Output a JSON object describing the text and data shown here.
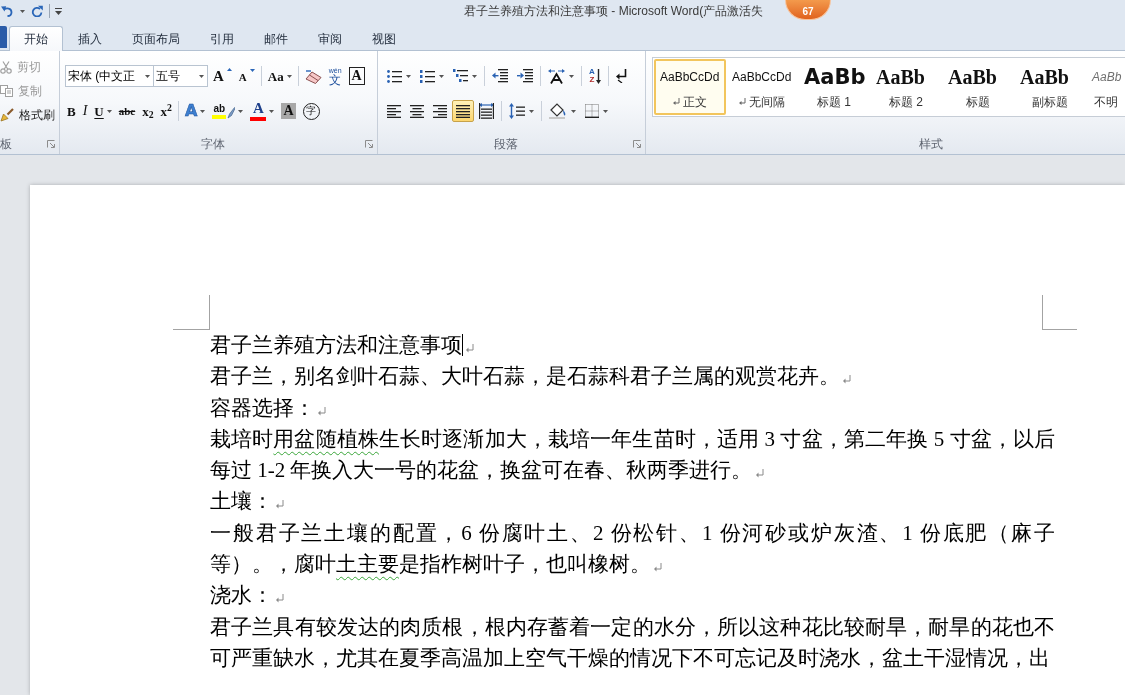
{
  "window": {
    "title": "君子兰养殖方法和注意事项 - Microsoft Word(产品激活失"
  },
  "badge": {
    "text": "67"
  },
  "tabs": [
    {
      "label": "开始",
      "selected": true
    },
    {
      "label": "插入",
      "selected": false
    },
    {
      "label": "页面布局",
      "selected": false
    },
    {
      "label": "引用",
      "selected": false
    },
    {
      "label": "邮件",
      "selected": false
    },
    {
      "label": "审阅",
      "selected": false
    },
    {
      "label": "视图",
      "selected": false
    }
  ],
  "clipboard": {
    "label": "板",
    "items": [
      {
        "kind": "cut",
        "label": "剪切",
        "disabled": true
      },
      {
        "kind": "copy",
        "label": "复制",
        "disabled": true
      },
      {
        "kind": "painter",
        "label": "格式刷",
        "disabled": false
      }
    ]
  },
  "font": {
    "label": "字体",
    "font_name": "宋体 (中文正",
    "font_size": "五号",
    "row_1": [
      [
        {
          "kind": "grow",
          "glyph": "A",
          "dropdown": false
        },
        {
          "kind": "shrink",
          "glyph": "A",
          "dropdown": false
        }
      ],
      [
        {
          "kind": "case",
          "glyph": "Aa",
          "dropdown": true
        }
      ],
      [
        {
          "kind": "clear",
          "dropdown": false
        },
        {
          "kind": "phonetic",
          "glyph": "文",
          "ruby": "wén",
          "dropdown": false
        },
        {
          "kind": "border",
          "glyph": "A",
          "dropdown": false
        }
      ]
    ],
    "row_2": [
      [
        {
          "kind": "bold",
          "glyph": "B",
          "dropdown": false
        },
        {
          "kind": "italic",
          "glyph": "I",
          "dropdown": false
        },
        {
          "kind": "underline",
          "glyph": "U",
          "dropdown": true
        },
        {
          "kind": "strike",
          "glyph": "abc",
          "dropdown": false
        },
        {
          "kind": "subscript",
          "glyph": "x$_{2}$",
          "dropdown": false
        },
        {
          "kind": "superscript",
          "glyph": "x$^{2}$",
          "dropdown": false
        }
      ],
      [
        {
          "kind": "effects",
          "glyph": "A",
          "dropdown": true
        },
        {
          "kind": "highlight",
          "glyph": "ab",
          "dropdown": true,
          "color": "#ffff00"
        },
        {
          "kind": "color",
          "glyph": "A",
          "dropdown": true,
          "color": "#ff0000"
        },
        {
          "kind": "shading",
          "glyph": "A",
          "dropdown": false
        },
        {
          "kind": "enclosed",
          "glyph": "字",
          "dropdown": false
        }
      ]
    ]
  },
  "paragraph": {
    "label": "段落",
    "row_1": [
      [
        {
          "kind": "bullets",
          "dropdown": true
        },
        {
          "kind": "numbering",
          "dropdown": true
        },
        {
          "kind": "multilevel",
          "dropdown": true
        }
      ],
      [
        {
          "kind": "outdent",
          "dropdown": false
        },
        {
          "kind": "indent",
          "dropdown": false
        }
      ],
      [
        {
          "kind": "asian_layout",
          "dropdown": true
        }
      ],
      [
        {
          "kind": "sort",
          "glyph": "A",
          "glyph_2": "Z",
          "dropdown": false
        }
      ],
      [
        {
          "kind": "show_marks",
          "dropdown": false
        }
      ]
    ],
    "row_2": [
      [
        {
          "kind": "align_left",
          "selected": false,
          "dropdown": false
        },
        {
          "kind": "align_center",
          "selected": false,
          "dropdown": false
        },
        {
          "kind": "align_right",
          "selected": false,
          "dropdown": false
        },
        {
          "kind": "justify",
          "selected": true,
          "dropdown": false
        },
        {
          "kind": "distribute",
          "selected": false,
          "dropdown": false
        }
      ],
      [
        {
          "kind": "line_spacing",
          "dropdown": true
        }
      ],
      [
        {
          "kind": "shading",
          "dropdown": true
        },
        {
          "kind": "borders",
          "dropdown": true
        }
      ]
    ]
  },
  "styles": {
    "label": "样式",
    "items": [
      {
        "kind": "normal",
        "sample": "AaBbCcDd",
        "label": "正文",
        "mark": true,
        "selected": true
      },
      {
        "kind": "no_spacing",
        "sample": "AaBbCcDd",
        "label": "无间隔",
        "mark": true,
        "selected": false
      },
      {
        "kind": "heading_1",
        "sample": "AaBb",
        "label": "标题 1",
        "mark": false,
        "selected": false
      },
      {
        "kind": "heading_2",
        "sample": "AaBb",
        "label": "标题 2",
        "mark": false,
        "selected": false
      },
      {
        "kind": "title",
        "sample": "AaBb",
        "label": "标题",
        "mark": false,
        "selected": false
      },
      {
        "kind": "subtitle",
        "sample": "AaBb",
        "label": "副标题",
        "mark": false,
        "selected": false
      },
      {
        "kind": "subtle",
        "sample": "AaBb",
        "label": "不明",
        "mark": false,
        "selected": false
      }
    ]
  },
  "document": {
    "paragraphs": [
      {
        "segments": [
          {
            "text": "君子兰养殖方法和注意事项",
            "flagged": false
          }
        ],
        "caret": true,
        "mark": true
      },
      {
        "segments": [
          {
            "text": "君子兰，别名剑叶石蒜、大叶石蒜，是石蒜科君子兰属的观赏花卉。",
            "flagged": false
          }
        ],
        "caret": false,
        "mark": true
      },
      {
        "segments": [
          {
            "text": "容器选择：",
            "flagged": false
          }
        ],
        "caret": false,
        "mark": true
      },
      {
        "segments": [
          {
            "text": "栽培时",
            "flagged": false
          },
          {
            "text": "用盆随植株",
            "flagged": true
          },
          {
            "text": "生长时逐渐加大，栽培一年生苗时，适用 3 寸盆，第二年换 5 寸盆，以后每过 1-2 年换入大一号的花盆，换盆可在春、秋两季进行。",
            "flagged": false
          }
        ],
        "caret": false,
        "mark": true
      },
      {
        "segments": [
          {
            "text": "土壤：",
            "flagged": false
          }
        ],
        "caret": false,
        "mark": true
      },
      {
        "segments": [
          {
            "text": "一般君子兰土壤的配置，6 份腐叶土、2 份松针、1 份河砂或炉灰渣、1 份底肥（麻子等）。，腐叶",
            "flagged": false
          },
          {
            "text": "土主要",
            "flagged": true
          },
          {
            "text": "是指柞树叶子，也叫橡树。",
            "flagged": false
          }
        ],
        "caret": false,
        "mark": true
      },
      {
        "segments": [
          {
            "text": "浇水：",
            "flagged": false
          }
        ],
        "caret": false,
        "mark": true
      },
      {
        "segments": [
          {
            "text": "君子兰具有较发达的肉质根，根内存蓄着一定的水分，所以这种花比较耐旱，耐旱的花也不可严重缺水，尤其在夏季高温加上空气干燥的情况下不可忘记及时浇水，盆土干湿情况，出",
            "flagged": false
          }
        ],
        "caret": false,
        "mark": false
      }
    ]
  }
}
